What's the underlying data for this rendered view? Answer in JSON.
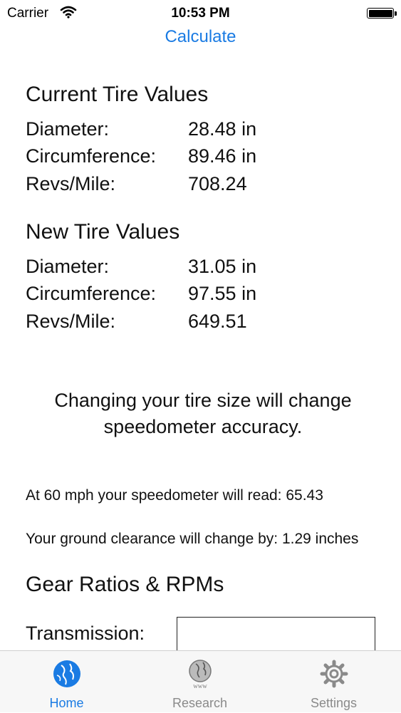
{
  "status_bar": {
    "carrier": "Carrier",
    "time": "10:53 PM"
  },
  "nav": {
    "title": "Calculate"
  },
  "current_tire": {
    "title": "Current Tire Values",
    "rows": [
      {
        "label": "Diameter:",
        "value": "28.48 in"
      },
      {
        "label": "Circumference:",
        "value": "89.46 in"
      },
      {
        "label": "Revs/Mile:",
        "value": "708.24"
      }
    ]
  },
  "new_tire": {
    "title": "New Tire Values",
    "rows": [
      {
        "label": "Diameter:",
        "value": "31.05 in"
      },
      {
        "label": "Circumference:",
        "value": "97.55 in"
      },
      {
        "label": "Revs/Mile:",
        "value": "649.51"
      }
    ]
  },
  "notice": {
    "text": "Changing your tire size will change speedometer accuracy."
  },
  "speedometer": {
    "text": "At 60 mph your speedometer will read: 65.43"
  },
  "clearance": {
    "text": "Your ground clearance will change by: 1.29 inches"
  },
  "gear": {
    "title": "Gear Ratios & RPMs",
    "transmission_label": "Transmission:",
    "transmission_value": ""
  },
  "tabs": [
    {
      "label": "Home",
      "icon": "globe-icon",
      "active": true
    },
    {
      "label": "Research",
      "icon": "www-globe-icon",
      "sublabel": "www",
      "active": false
    },
    {
      "label": "Settings",
      "icon": "gear-icon",
      "active": false
    }
  ],
  "colors": {
    "accent": "#1a7be3",
    "tab_inactive": "#8a8a8a"
  }
}
